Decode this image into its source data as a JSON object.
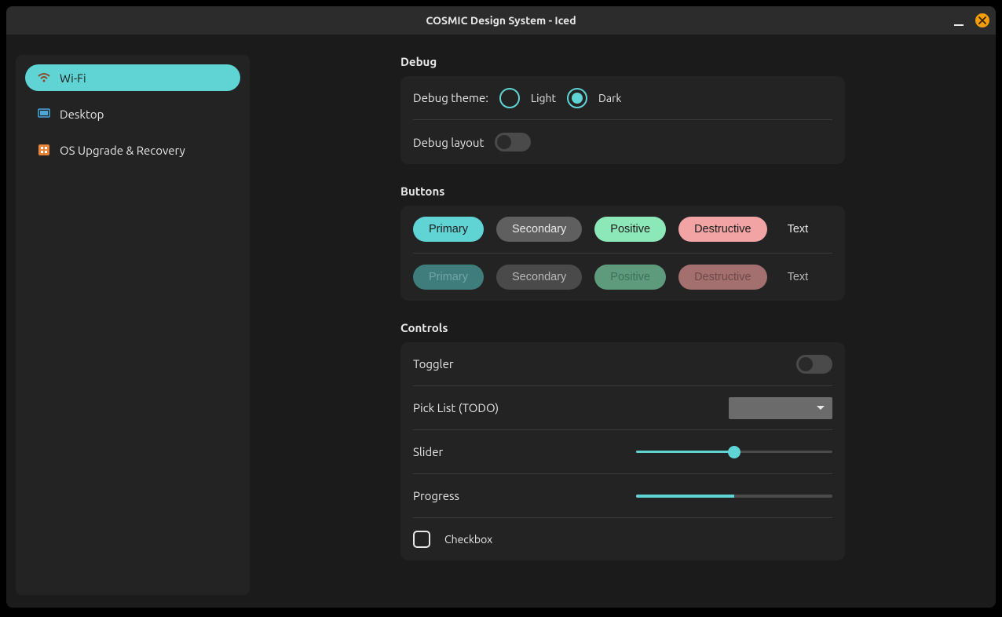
{
  "window": {
    "title": "COSMIC Design System - Iced"
  },
  "sidebar": {
    "items": [
      {
        "label": "Wi-Fi",
        "icon": "wifi",
        "active": true
      },
      {
        "label": "Desktop",
        "icon": "desktop",
        "active": false
      },
      {
        "label": "OS Upgrade & Recovery",
        "icon": "recovery",
        "active": false
      }
    ]
  },
  "sections": {
    "debug": {
      "title": "Debug",
      "theme_label": "Debug theme:",
      "options": {
        "light": "Light",
        "dark": "Dark"
      },
      "selected": "dark",
      "layout_label": "Debug layout",
      "layout_on": false
    },
    "buttons": {
      "title": "Buttons",
      "labels": {
        "primary": "Primary",
        "secondary": "Secondary",
        "positive": "Positive",
        "destructive": "Destructive",
        "text": "Text"
      }
    },
    "controls": {
      "title": "Controls",
      "toggler_label": "Toggler",
      "toggler_on": false,
      "picklist_label": "Pick List (TODO)",
      "slider_label": "Slider",
      "slider_value": 50,
      "progress_label": "Progress",
      "progress_value": 50,
      "checkbox_label": "Checkbox",
      "checkbox_checked": false
    }
  },
  "colors": {
    "accent": "#60d4d4",
    "positive": "#8ce8b8",
    "destructive": "#f2a3a3",
    "secondary": "#5f5f5f"
  }
}
